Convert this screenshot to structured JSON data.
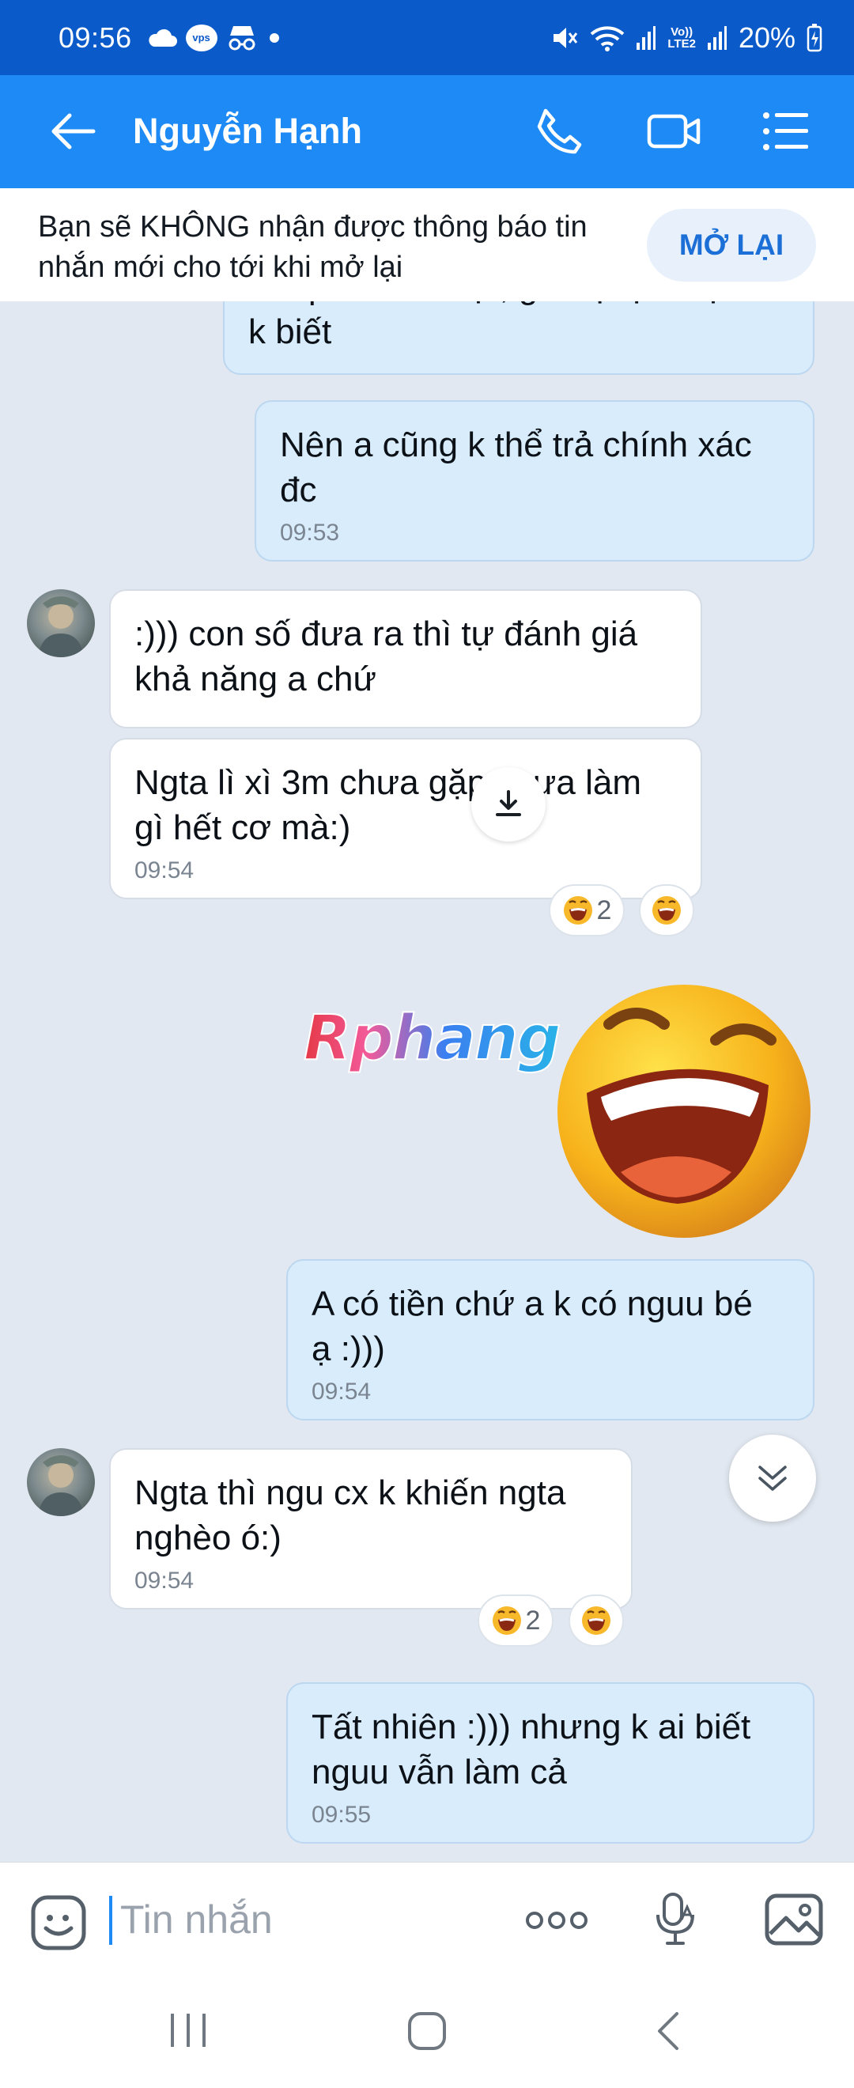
{
  "status_bar": {
    "time": "09:56",
    "battery_percent": "20%",
    "lte_label_top": "Vo))",
    "lte_label_bottom": "LTE2",
    "vps_label": "vps"
  },
  "header": {
    "title": "Nguyễn Hạnh",
    "back_icon": "arrow-left-icon",
    "call_icon": "phone-icon",
    "video_icon": "video-camera-icon",
    "menu_icon": "list-menu-icon"
  },
  "banner": {
    "text": "Bạn sẽ KHÔNG nhận được thông báo tin nhắn mới cho tới khi mở lại",
    "button_label": "MỞ LẠI"
  },
  "messages": [
    {
      "id": "m1",
      "direction": "out",
      "text": "Thấp thì a có lợi, giá trị dịch vụ a\nk biết",
      "time": ""
    },
    {
      "id": "m2",
      "direction": "out",
      "text": "Nên a cũng k thể trả chính xác\nđc",
      "time": "09:53"
    },
    {
      "id": "m3",
      "direction": "in",
      "text": ":))) con số đưa ra thì tự đánh giá\nkhả năng a chứ",
      "time": ""
    },
    {
      "id": "m4",
      "direction": "in",
      "text": "Ngta lì xì 3m chưa gặp chưa làm\ngì hết cơ mà:)",
      "time": "09:54"
    },
    {
      "id": "m5",
      "direction": "out",
      "text": "A có tiền chứ a k có nguu bé\nạ :)))",
      "time": "09:54"
    },
    {
      "id": "m6",
      "direction": "in",
      "text": "Ngta thì ngu cx k khiến ngta\nnghèo ó:)",
      "time": "09:54"
    },
    {
      "id": "m7",
      "direction": "out",
      "text": "Tất nhiên :))) nhưng k ai biết\nnguu vẫn làm cả",
      "time": "09:55"
    }
  ],
  "reactions": {
    "r1_count": "2",
    "r2_count": "2",
    "emoji": "laughing-face-icon"
  },
  "sticker": {
    "watermark": "Rphang",
    "emoji": "laughing-face-sticker"
  },
  "input": {
    "placeholder": "Tin nhắn",
    "sticker_icon": "sticker-face-icon",
    "more_icon": "more-dots-icon",
    "voice_icon": "voice-text-icon",
    "image_icon": "image-gallery-icon"
  },
  "nav": {
    "recent_icon": "recent-apps-icon",
    "home_icon": "home-icon",
    "back_icon": "back-chevron-icon"
  },
  "colors": {
    "status_bar": "#0a5ac9",
    "header": "#1e8af5",
    "outgoing_bubble": "#d8ecfb",
    "incoming_bubble": "#ffffff",
    "chat_background": "#e2e8f1"
  }
}
